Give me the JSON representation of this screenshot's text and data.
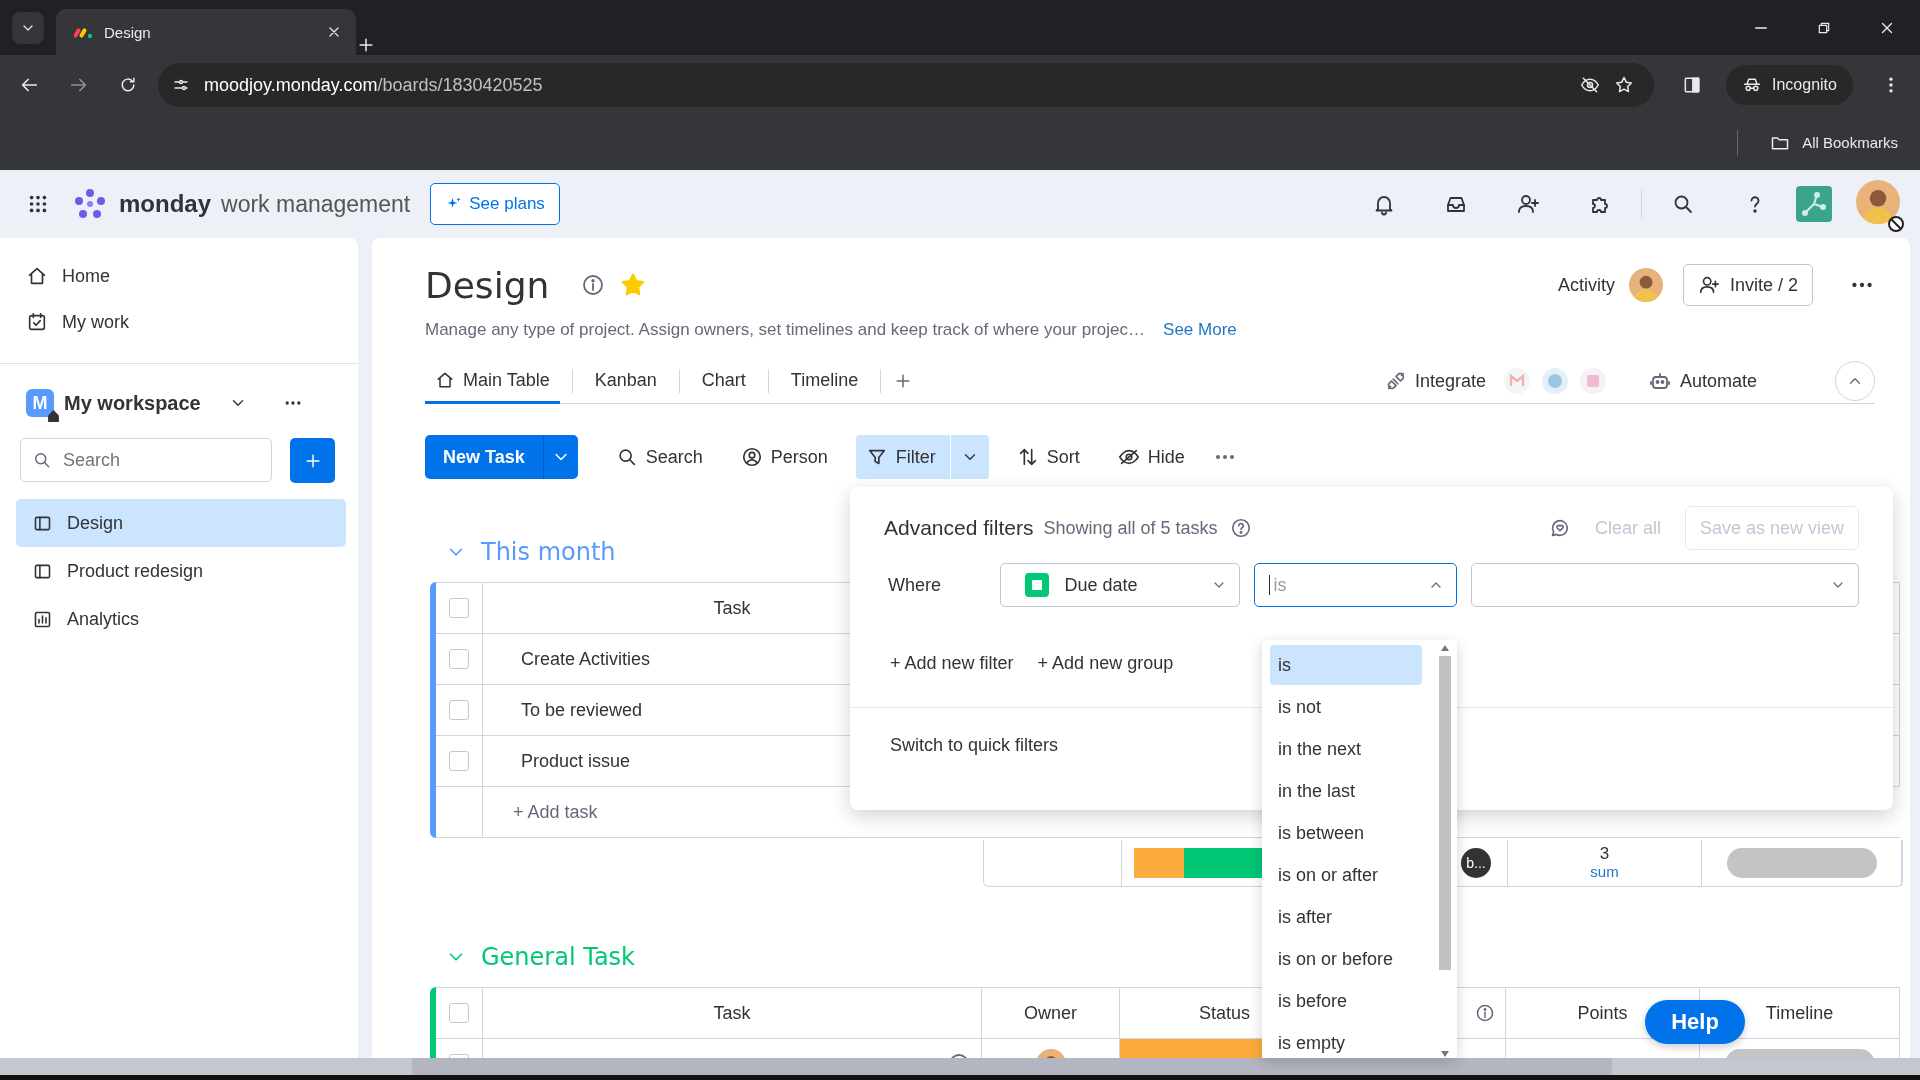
{
  "browser": {
    "tab_title": "Design",
    "url_host": "moodjoy.monday.com",
    "url_path": "/boards/1830420525",
    "profile": "Incognito",
    "bookmarks": "All Bookmarks"
  },
  "topbar": {
    "brand": "monday",
    "product": "work management",
    "plans_button": "See plans"
  },
  "sidebar": {
    "nav": [
      {
        "label": "Home"
      },
      {
        "label": "My work"
      }
    ],
    "workspace": {
      "initial": "M",
      "name": "My workspace"
    },
    "search": {
      "placeholder": "Search"
    },
    "boards": [
      {
        "label": "Design",
        "kind": "board",
        "selected": true
      },
      {
        "label": "Product redesign",
        "kind": "board",
        "selected": false
      },
      {
        "label": "Analytics",
        "kind": "dashboard",
        "selected": false
      }
    ]
  },
  "board": {
    "title": "Design",
    "starred": true,
    "description": "Manage any type of project. Assign owners, set timelines and keep track of where your projec…",
    "see_more": "See More",
    "activity": "Activity",
    "invite": "Invite / 2",
    "views": [
      {
        "label": "Main Table",
        "selected": true
      },
      {
        "label": "Kanban",
        "selected": false
      },
      {
        "label": "Chart",
        "selected": false
      },
      {
        "label": "Timeline",
        "selected": false
      }
    ],
    "integrate": "Integrate",
    "automate": "Automate",
    "new_task": "New Task",
    "tools": [
      {
        "label": "Search",
        "kind": "search",
        "selected": false
      },
      {
        "label": "Person",
        "kind": "person",
        "selected": false
      },
      {
        "label": "Filter",
        "kind": "filter",
        "selected": true
      },
      {
        "label": "Sort",
        "kind": "sort",
        "selected": false
      },
      {
        "label": "Hide",
        "kind": "hide",
        "selected": false
      }
    ]
  },
  "groups": [
    {
      "title": "This month",
      "color": "#579bfc",
      "all_checked": false,
      "columns": [
        "Task"
      ],
      "rows": [
        {
          "task": "Create Activities",
          "checked": false
        },
        {
          "task": "To be reviewed",
          "checked": false
        },
        {
          "task": "Product issue",
          "checked": false
        }
      ],
      "add_task": "+ Add task",
      "summary": {
        "owner_badge": "b...",
        "points": "3",
        "points_label": "sum"
      }
    },
    {
      "title": "General Task",
      "color": "#00c875",
      "all_checked": false,
      "columns": [
        "Task",
        "Owner",
        "Status",
        "Points",
        "Timeline"
      ],
      "rows": [
        {
          "checked": false
        }
      ]
    }
  ],
  "filter": {
    "title": "Advanced filters",
    "summary": "Showing all of 5 tasks",
    "clear_all": {
      "label": "Clear all",
      "disabled": true
    },
    "save_view": {
      "label": "Save as new view",
      "disabled": true
    },
    "where": "Where",
    "column": "Due date",
    "condition": {
      "value": "is",
      "focused": true
    },
    "add_filter": "+ Add new filter",
    "add_group": "+ Add new group",
    "switch": "Switch to quick filters",
    "options": [
      {
        "label": "is",
        "selected": true
      },
      {
        "label": "is not",
        "selected": false
      },
      {
        "label": "in the next",
        "selected": false
      },
      {
        "label": "in the last",
        "selected": false
      },
      {
        "label": "is between",
        "selected": false
      },
      {
        "label": "is on or after",
        "selected": false
      },
      {
        "label": "is after",
        "selected": false
      },
      {
        "label": "is on or before",
        "selected": false
      },
      {
        "label": "is before",
        "selected": false
      },
      {
        "label": "is empty",
        "selected": false
      }
    ]
  },
  "help": "Help"
}
